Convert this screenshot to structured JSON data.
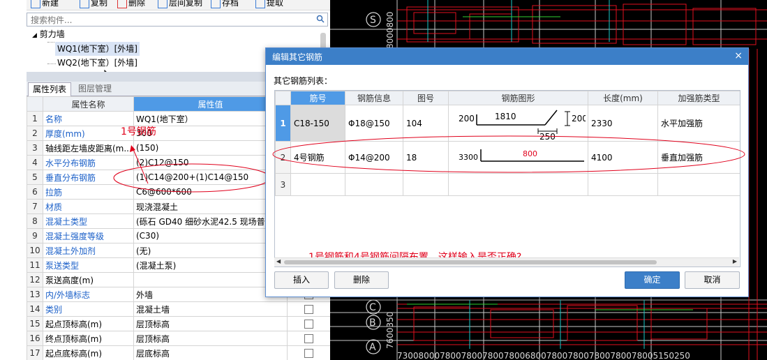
{
  "toolbar": {
    "items": [
      {
        "label": "新建",
        "icon": "new-icon"
      },
      {
        "label": "复制",
        "icon": "copy-icon"
      },
      {
        "label": "删除",
        "icon": "delete-icon"
      },
      {
        "label": "层间复制",
        "icon": "floor-copy-icon"
      },
      {
        "label": "存档",
        "icon": "save-icon"
      },
      {
        "label": "提取",
        "icon": "extract-icon"
      }
    ]
  },
  "search": {
    "placeholder": "搜索构件..."
  },
  "tree": {
    "group": "剪力墙",
    "items": [
      "WQ1(地下室）[外墙]",
      "WQ2(地下室）[外墙]"
    ]
  },
  "tabs": [
    "属性列表",
    "图层管理"
  ],
  "properties": {
    "header": {
      "name": "属性名称",
      "value": "属性值"
    },
    "rows": [
      {
        "n": "1",
        "name": "名称",
        "value": "WQ1(地下室）",
        "blue": true,
        "cb": false
      },
      {
        "n": "2",
        "name": "厚度(mm)",
        "value": "300",
        "blue": true,
        "cb": false
      },
      {
        "n": "3",
        "name": "轴线距左墙皮距离(m...",
        "value": "(150)",
        "blue": false,
        "cb": false
      },
      {
        "n": "4",
        "name": "水平分布钢筋",
        "value": "(2)C12@150",
        "blue": true,
        "cb": false
      },
      {
        "n": "5",
        "name": "垂直分布钢筋",
        "value": "(1)C14@200+(1)C14@150",
        "blue": true,
        "cb": false
      },
      {
        "n": "6",
        "name": "拉筋",
        "value": "C6@600*600",
        "blue": true,
        "cb": false
      },
      {
        "n": "7",
        "name": "材质",
        "value": "现浇混凝土",
        "blue": true,
        "cb": false
      },
      {
        "n": "8",
        "name": "混凝土类型",
        "value": "(砾石 GD40 细砂水泥42.5 现场普",
        "blue": true,
        "cb": false
      },
      {
        "n": "9",
        "name": "混凝土强度等级",
        "value": "(C30)",
        "blue": true,
        "cb": false
      },
      {
        "n": "10",
        "name": "混凝土外加剂",
        "value": "(无)",
        "blue": true,
        "cb": false
      },
      {
        "n": "11",
        "name": "泵送类型",
        "value": "(混凝土泵)",
        "blue": true,
        "cb": false
      },
      {
        "n": "12",
        "name": "泵送高度(m)",
        "value": "",
        "blue": false,
        "cb": false
      },
      {
        "n": "13",
        "name": "内/外墙标志",
        "value": "外墙",
        "blue": true,
        "cb": true
      },
      {
        "n": "14",
        "name": "类别",
        "value": "混凝土墙",
        "blue": true,
        "cb": true
      },
      {
        "n": "15",
        "name": "起点顶标高(m)",
        "value": "层顶标高",
        "blue": false,
        "cb": true
      },
      {
        "n": "16",
        "name": "终点顶标高(m)",
        "value": "层顶标高",
        "blue": false,
        "cb": true
      },
      {
        "n": "17",
        "name": "起点底标高(m)",
        "value": "层底标高",
        "blue": false,
        "cb": true
      }
    ]
  },
  "annotation_left": "1号钢筋",
  "dialog": {
    "title": "编辑其它钢筋",
    "close": "×",
    "list_label": "其它钢筋列表：",
    "columns": [
      "筋号",
      "钢筋信息",
      "图号",
      "钢筋图形",
      "长度(mm)",
      "加强筋类型"
    ],
    "rows": [
      {
        "n": "1",
        "bar": "C18-150",
        "info": "Φ18@150",
        "fig": "104",
        "length": "2330",
        "type": "水平加强筋",
        "shape": {
          "d1": "200",
          "d2": "1810",
          "d3": "200",
          "d4": "250"
        }
      },
      {
        "n": "2",
        "bar": "4号钢筋",
        "info": "Φ14@200",
        "fig": "18",
        "length": "4100",
        "type": "垂直加强筋",
        "shape": {
          "d1": "3300",
          "d2": "800"
        }
      },
      {
        "n": "3",
        "bar": "",
        "info": "",
        "fig": "",
        "length": "",
        "type": ""
      }
    ],
    "question": "1号钢筋和4号钢筋间隔布置，这样输入是否正确?",
    "buttons": {
      "insert": "插入",
      "delete": "删除",
      "ok": "确定",
      "cancel": "取消"
    }
  },
  "cad": {
    "axis_labels": [
      "C",
      "B",
      "A"
    ],
    "axis_label_top": "S",
    "dim_bottom": "7300800078007800780078006800780078007800780078005150250",
    "dim_left_top": "8000800",
    "dim_left_bottom": "7600350"
  },
  "colors": {
    "accent": "#3c7fc8",
    "selection": "#4f9ae6",
    "annotation": "#e0001b",
    "cad_bg": "#000000"
  }
}
